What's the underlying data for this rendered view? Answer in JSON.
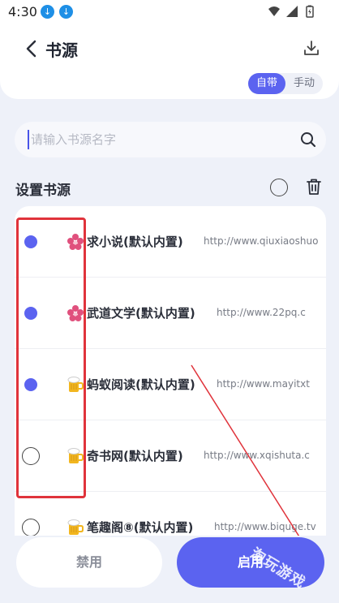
{
  "status_bar": {
    "time": "4:30",
    "notifications": [
      "download-icon",
      "download-icon"
    ],
    "icons": [
      "wifi-icon",
      "signal-icon",
      "battery-icon"
    ]
  },
  "header": {
    "title": "书源",
    "segment": {
      "options": [
        "自带",
        "手动"
      ],
      "selected": "自带"
    }
  },
  "search": {
    "placeholder": "请输入书源名字",
    "value": ""
  },
  "section": {
    "title": "设置书源"
  },
  "sources": [
    {
      "name": "求小说(默认内置)",
      "url": "http://www.qiuxiaoshuo",
      "icon": "flower-icon",
      "checked": true
    },
    {
      "name": "武道文学(默认内置)",
      "url": "http://www.22pq.c",
      "icon": "flower-icon",
      "checked": true
    },
    {
      "name": "蚂蚁阅读(默认内置)",
      "url": "http://www.mayitxt",
      "icon": "beer-mug-icon",
      "checked": true
    },
    {
      "name": "奇书网(默认内置)",
      "url": "http://www.xqishuta.c",
      "icon": "beer-mug-icon",
      "checked": false
    },
    {
      "name": "笔趣阁⑧(默认内置)",
      "url": "http://www.biquge.tv",
      "icon": "beer-mug-icon",
      "checked": false
    }
  ],
  "actions": {
    "disable_label": "禁用",
    "enable_label": "启用"
  },
  "watermark": "淘玩游戏",
  "colors": {
    "accent": "#5b63f0",
    "annotation": "#e0333b"
  }
}
